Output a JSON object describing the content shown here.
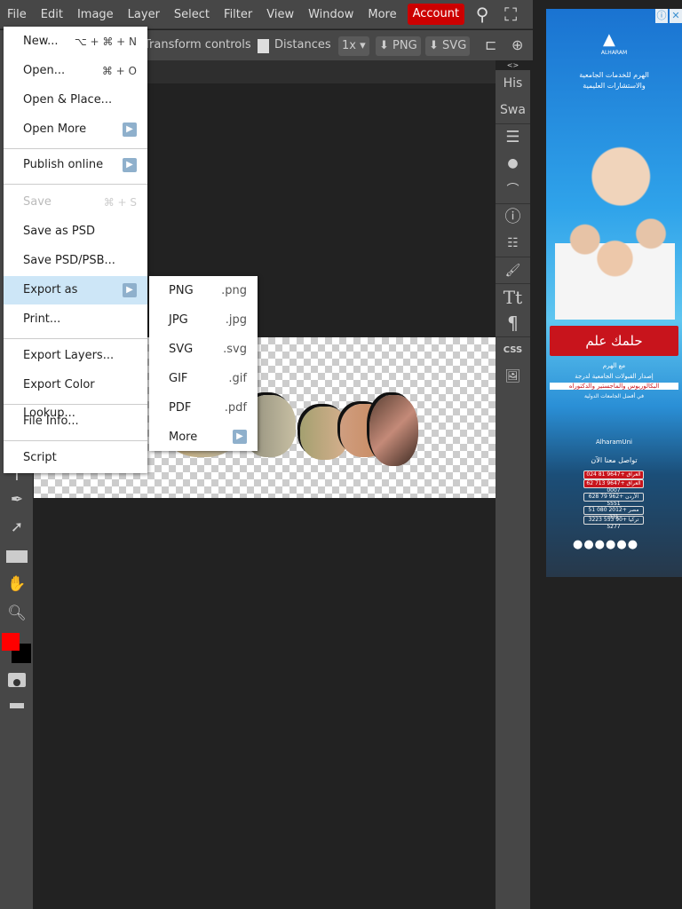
{
  "menubar": {
    "items": [
      "File",
      "Edit",
      "Image",
      "Layer",
      "Select",
      "Filter",
      "View",
      "Window",
      "More"
    ],
    "account": "Account"
  },
  "options": {
    "transform": "Transform controls",
    "distances": "Distances",
    "scale": "1x",
    "png": "PNG",
    "svg": "SVG"
  },
  "right_panel": {
    "collapse": "<>",
    "history": "His",
    "swatches": "Swa",
    "css": "CSS"
  },
  "file_menu": {
    "new": {
      "label": "New...",
      "shortcut": "⌥ + ⌘ + N"
    },
    "open": {
      "label": "Open...",
      "shortcut": "⌘ + O"
    },
    "open_place": "Open & Place...",
    "open_more": "Open More",
    "publish": "Publish online",
    "save": {
      "label": "Save",
      "shortcut": "⌘ + S"
    },
    "save_psd": "Save as PSD",
    "save_psb": "Save PSD/PSB...",
    "export_as": "Export as",
    "print": "Print...",
    "export_layers": "Export Layers...",
    "export_lookup": "Export Color Lookup...",
    "file_info": "File Info...",
    "script": "Script"
  },
  "export_menu": [
    {
      "label": "PNG",
      "ext": ".png"
    },
    {
      "label": "JPG",
      "ext": ".jpg"
    },
    {
      "label": "SVG",
      "ext": ".svg"
    },
    {
      "label": "GIF",
      "ext": ".gif"
    },
    {
      "label": "PDF",
      "ext": ".pdf"
    },
    {
      "label": "More",
      "ext": ""
    }
  ],
  "colors": {
    "foreground": "#ff0000",
    "background": "#000000",
    "account": "#cc0000"
  },
  "ad": {
    "brand": "ALHARAM",
    "title1": "الهرم للخدمات الجامعية",
    "title2": "والاستشارات العليمية",
    "banner": "حلمك علم",
    "banner_sub": "مع الهرم",
    "line1": "إصدار القبولات الجامعية لدرجة",
    "line2": "البكالوريوس والماجستير والدكتوراه",
    "line3": "في أفضل الجامعات الدولية",
    "social": "AlharamUni",
    "contact": "تواصل معنا الآن",
    "phones": [
      "العراق +9647 81 024 0007",
      "العراق +9647 713 62 0007",
      "الأردن +962 79 628 5551",
      "مصر +2012 080 51 331",
      "تركيا +90 553 3223 5277"
    ]
  }
}
